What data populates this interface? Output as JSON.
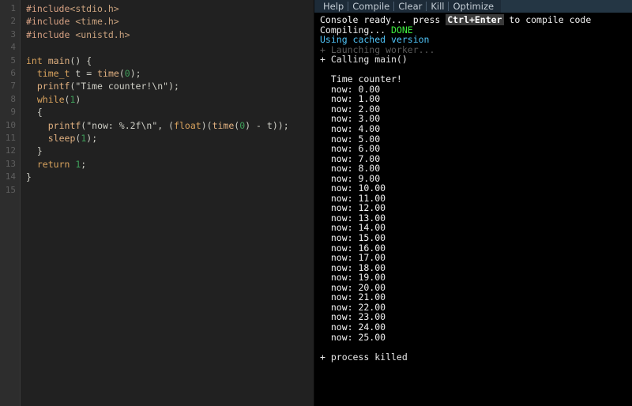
{
  "editor": {
    "line_numbers": [
      "1",
      "2",
      "3",
      "4",
      "5",
      "6",
      "7",
      "8",
      "9",
      "10",
      "11",
      "12",
      "13",
      "14",
      "15"
    ],
    "code_lines": [
      "#include<stdio.h>",
      "#include <time.h>",
      "#include <unistd.h>",
      "",
      "int main() {",
      "  time_t t = time(0);",
      "  printf(\"Time counter!\\n\");",
      "  while(1)",
      "  {",
      "    printf(\"now: %.2f\\n\", (float)(time(0) - t));",
      "    sleep(1);",
      "  }",
      "  return 1;",
      "}",
      ""
    ]
  },
  "toolbar": {
    "buttons": [
      {
        "label": "Help",
        "name": "help-button"
      },
      {
        "label": "Compile",
        "name": "compile-button"
      },
      {
        "label": "Clear",
        "name": "clear-button"
      },
      {
        "label": "Kill",
        "name": "kill-button"
      },
      {
        "label": "Optimize",
        "name": "optimize-button"
      }
    ]
  },
  "console": {
    "ready_prefix": "Console ready... press ",
    "ready_key": "Ctrl+Enter",
    "ready_suffix": " to compile code",
    "compiling_label": "Compiling... ",
    "compiling_status": "DONE",
    "cache_line": "Using cached version",
    "launching_line": "+ Launching worker...",
    "calling_line": "+ Calling main()",
    "program_header": "  Time counter!",
    "output_lines": [
      "  now: 0.00",
      "  now: 1.00",
      "  now: 2.00",
      "  now: 3.00",
      "  now: 4.00",
      "  now: 5.00",
      "  now: 6.00",
      "  now: 7.00",
      "  now: 8.00",
      "  now: 9.00",
      "  now: 10.00",
      "  now: 11.00",
      "  now: 12.00",
      "  now: 13.00",
      "  now: 14.00",
      "  now: 15.00",
      "  now: 16.00",
      "  now: 17.00",
      "  now: 18.00",
      "  now: 19.00",
      "  now: 20.00",
      "  now: 21.00",
      "  now: 22.00",
      "  now: 23.00",
      "  now: 24.00",
      "  now: 25.00"
    ],
    "killed_line": "+ process killed"
  },
  "colors": {
    "editor_bg": "#212121",
    "gutter_bg": "#2d2d2d",
    "console_bg": "#000000",
    "toolbar_bg": "#1d2b38",
    "toolbar_filler_bg": "#243644",
    "status_done": "#3ff03f",
    "status_cache": "#4fc3f7",
    "dim_text": "#5a5a5a"
  }
}
